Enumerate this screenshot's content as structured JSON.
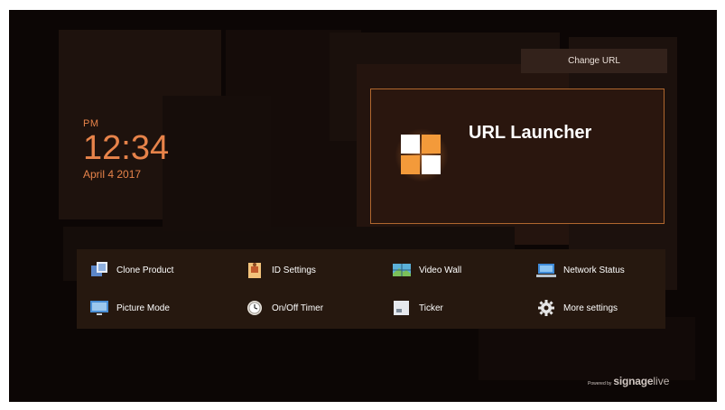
{
  "clock": {
    "ampm": "PM",
    "time": "12:34",
    "date": "April 4 2017"
  },
  "header": {
    "change_url_label": "Change URL"
  },
  "launcher": {
    "title": "URL Launcher",
    "icon": "url-launcher-grid-icon"
  },
  "menu": {
    "items": [
      {
        "label": "Clone Product",
        "icon": "clone-product-icon"
      },
      {
        "label": "ID Settings",
        "icon": "id-settings-icon"
      },
      {
        "label": "Video Wall",
        "icon": "video-wall-icon"
      },
      {
        "label": "Network Status",
        "icon": "network-status-icon"
      },
      {
        "label": "Picture Mode",
        "icon": "picture-mode-icon"
      },
      {
        "label": "On/Off Timer",
        "icon": "timer-icon"
      },
      {
        "label": "Ticker",
        "icon": "ticker-icon"
      },
      {
        "label": "More settings",
        "icon": "gear-icon"
      }
    ]
  },
  "footer": {
    "powered_by": "Powered by",
    "brand": "signage",
    "brand_suffix": "live"
  },
  "colors": {
    "accent": "#e7834a",
    "frame": "#b0672e",
    "background": "#0c0605",
    "panel": "#26180f"
  }
}
